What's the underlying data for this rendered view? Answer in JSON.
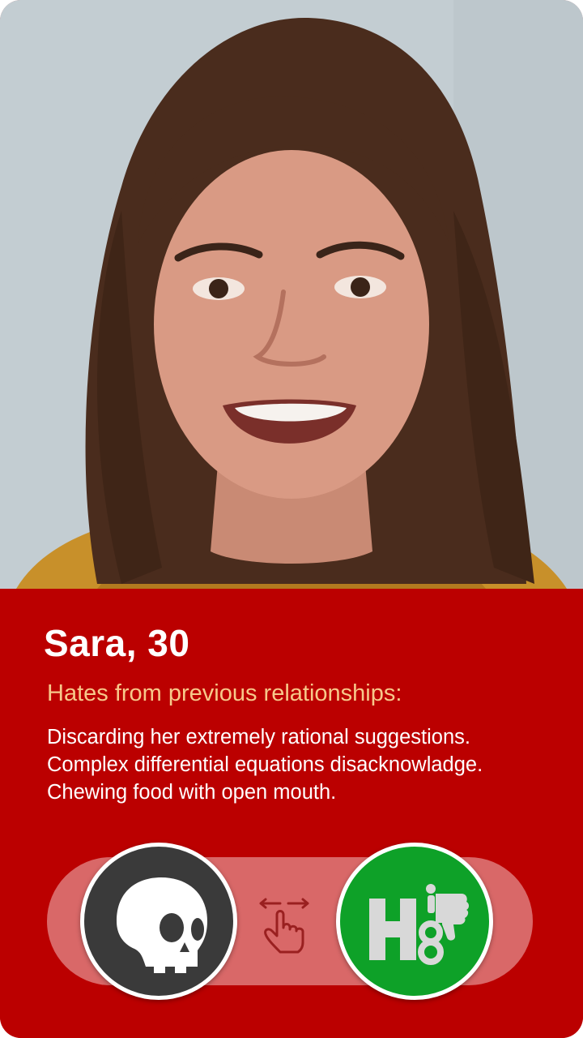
{
  "profile": {
    "name_age": "Sara, 30",
    "section_title": "Hates from previous relationships:",
    "hates": [
      "Discarding her extremely rational suggestions.",
      "Complex differential equations disacknowladge.",
      "Chewing food with open mouth."
    ]
  },
  "actions": {
    "skull_button_icon": "skull-icon",
    "swipe_hint_icon": "swipe-hand-icon",
    "h8_button_icon": "h8-thumbs-down-logo",
    "h8_logo_text": "H8"
  },
  "colors": {
    "panel_red": "#bb0000",
    "section_title": "#f7c88a",
    "track": "#d96868",
    "skull_button": "#3a3a3a",
    "h8_button": "#0ea128"
  }
}
